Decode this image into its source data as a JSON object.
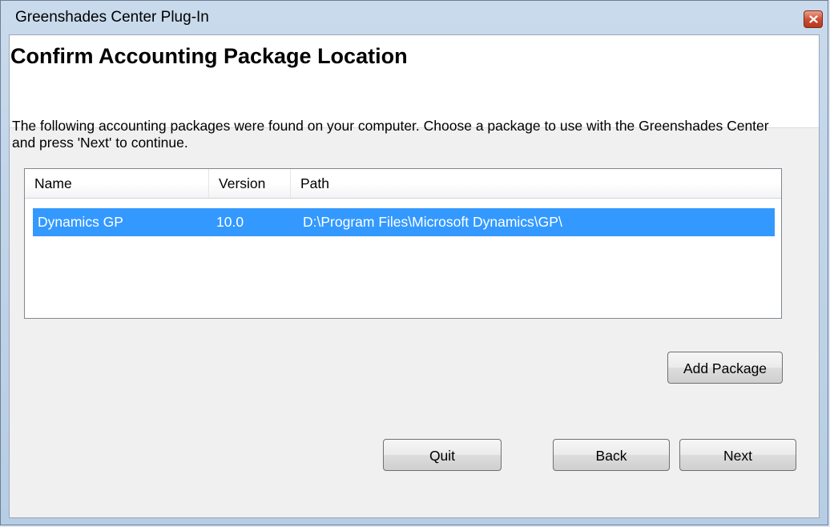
{
  "window": {
    "title": "Greenshades Center Plug-In"
  },
  "header": {
    "title": "Confirm Accounting Package Location"
  },
  "instructions": "The following accounting packages were found on your computer.  Choose a package to use with the Greenshades Center and press 'Next' to continue.",
  "packages_table": {
    "columns": [
      "Name",
      "Version",
      "Path"
    ],
    "rows": [
      {
        "name": "Dynamics GP",
        "version": "10.0",
        "path": "D:\\Program Files\\Microsoft Dynamics\\GP\\",
        "selected": true
      }
    ]
  },
  "buttons": {
    "add_package": "Add Package",
    "quit": "Quit",
    "back": "Back",
    "next": "Next"
  },
  "icons": {
    "close": "close-icon"
  },
  "colors": {
    "selection": "#3399ff",
    "close_button": "#c94a2f"
  }
}
